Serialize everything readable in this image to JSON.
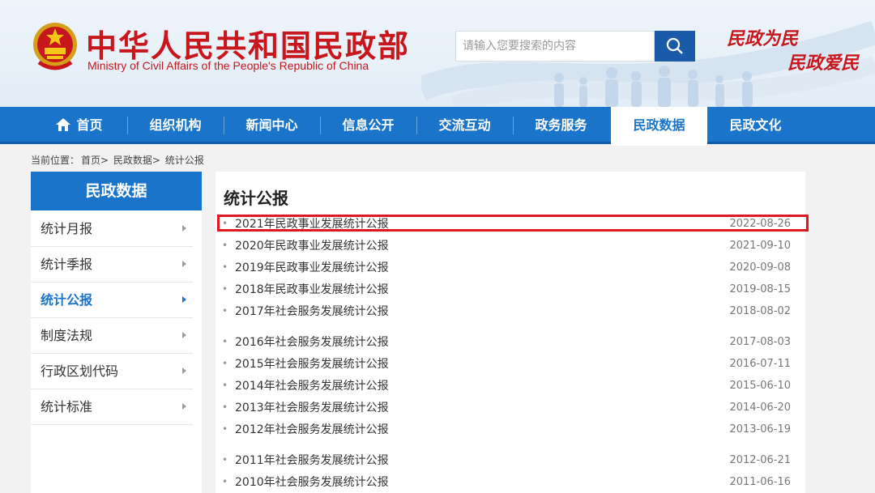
{
  "header": {
    "site_name_cn": "中华人民共和国民政部",
    "site_name_en": "Ministry of Civil Affairs of the People's Republic of China",
    "search_placeholder": "请输入您要搜索的内容",
    "slogan_line1": "民政为民",
    "slogan_line2": "民政爱民"
  },
  "nav": {
    "items": [
      {
        "label": "首页"
      },
      {
        "label": "组织机构"
      },
      {
        "label": "新闻中心"
      },
      {
        "label": "信息公开"
      },
      {
        "label": "交流互动"
      },
      {
        "label": "政务服务"
      },
      {
        "label": "民政数据"
      },
      {
        "label": "民政文化"
      }
    ],
    "active_index": 6
  },
  "breadcrumb": {
    "prefix": "当前位置：",
    "items": [
      "首页>",
      "民政数据>",
      "统计公报"
    ]
  },
  "sidebar": {
    "title": "民政数据",
    "items": [
      {
        "label": "统计月报"
      },
      {
        "label": "统计季报"
      },
      {
        "label": "统计公报"
      },
      {
        "label": "制度法规"
      },
      {
        "label": "行政区划代码"
      },
      {
        "label": "统计标准"
      }
    ],
    "active_index": 2
  },
  "main": {
    "title": "统计公报",
    "items": [
      {
        "title": "2021年民政事业发展统计公报",
        "date": "2022-08-26"
      },
      {
        "title": "2020年民政事业发展统计公报",
        "date": "2021-09-10"
      },
      {
        "title": "2019年民政事业发展统计公报",
        "date": "2020-09-08"
      },
      {
        "title": "2018年民政事业发展统计公报",
        "date": "2019-08-15"
      },
      {
        "title": "2017年社会服务发展统计公报",
        "date": "2018-08-02"
      },
      {
        "title": "2016年社会服务发展统计公报",
        "date": "2017-08-03"
      },
      {
        "title": "2015年社会服务发展统计公报",
        "date": "2016-07-11"
      },
      {
        "title": "2014年社会服务发展统计公报",
        "date": "2015-06-10"
      },
      {
        "title": "2013年社会服务发展统计公报",
        "date": "2014-06-20"
      },
      {
        "title": "2012年社会服务发展统计公报",
        "date": "2013-06-19"
      },
      {
        "title": "2011年社会服务发展统计公报",
        "date": "2012-06-21"
      },
      {
        "title": "2010年社会服务发展统计公报",
        "date": "2011-06-16"
      }
    ],
    "highlighted_index": 0
  },
  "colors": {
    "brand_red": "#c8161d",
    "nav_blue": "#1a74c9",
    "highlight_red": "#e0171f"
  }
}
